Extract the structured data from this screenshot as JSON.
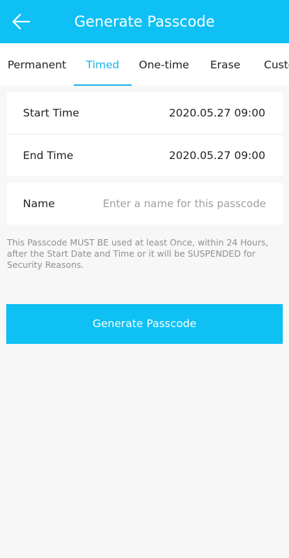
{
  "header": {
    "title": "Generate Passcode",
    "back_icon": "back-arrow-icon"
  },
  "tabs": [
    {
      "label": "Permanent",
      "active": false
    },
    {
      "label": "Timed",
      "active": true
    },
    {
      "label": "One-time",
      "active": false
    },
    {
      "label": "Erase",
      "active": false
    },
    {
      "label": "Custom",
      "active": false
    }
  ],
  "time_card": {
    "start_label": "Start Time",
    "start_value": "2020.05.27 09:00",
    "end_label": "End Time",
    "end_value": "2020.05.27 09:00"
  },
  "name_card": {
    "label": "Name",
    "placeholder": "Enter a name for this passcode",
    "value": ""
  },
  "notice": "This Passcode MUST BE used at least Once, within 24 Hours, after the Start Date and Time or it will be SUSPENDED for Security Reasons.",
  "generate_button": "Generate Passcode",
  "colors": {
    "accent": "#0ec0f4",
    "tab_active": "#16b5ea",
    "background": "#f7f7f7"
  }
}
